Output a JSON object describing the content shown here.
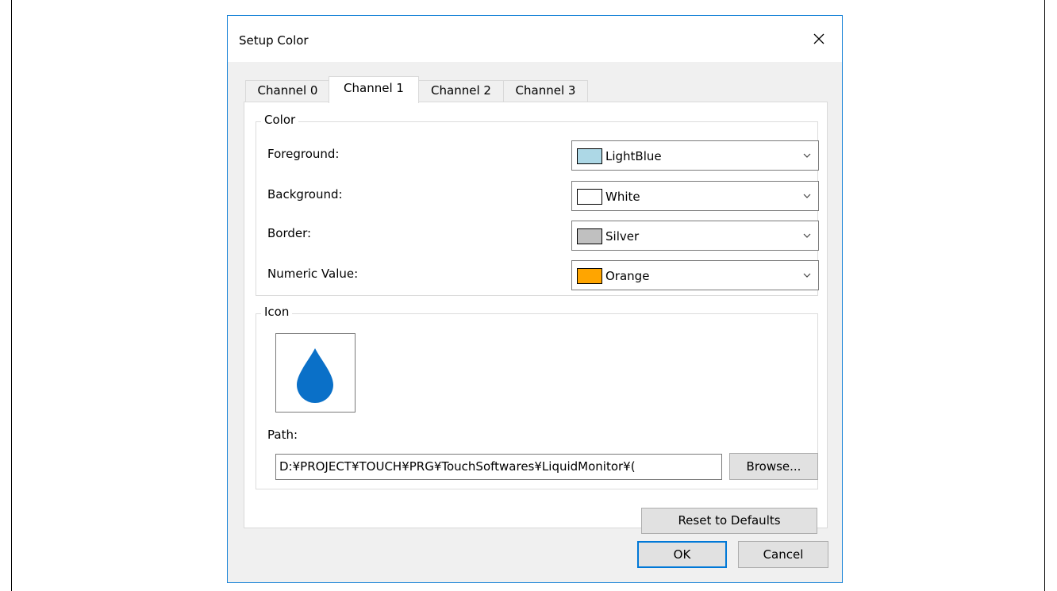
{
  "dialog": {
    "title": "Setup Color",
    "tabs": [
      {
        "label": "Channel 0",
        "active": false
      },
      {
        "label": "Channel 1",
        "active": true
      },
      {
        "label": "Channel 2",
        "active": false
      },
      {
        "label": "Channel 3",
        "active": false
      }
    ],
    "color_group": {
      "legend": "Color",
      "rows": [
        {
          "label": "Foreground:",
          "value": "LightBlue",
          "swatch": "#add8e6"
        },
        {
          "label": "Background:",
          "value": "White",
          "swatch": "#ffffff"
        },
        {
          "label": "Border:",
          "value": "Silver",
          "swatch": "#c0c0c0"
        },
        {
          "label": "Numeric Value:",
          "value": "Orange",
          "swatch": "#ffa500"
        }
      ]
    },
    "icon_group": {
      "legend": "Icon",
      "icon": "water-drop-icon",
      "icon_color": "#0a70c8",
      "path_label": "Path:",
      "path_value": "D:¥PROJECT¥TOUCH¥PRG¥TouchSoftwares¥LiquidMonitor¥(",
      "browse_label": "Browse..."
    },
    "reset_label": "Reset to Defaults",
    "ok_label": "OK",
    "cancel_label": "Cancel"
  }
}
